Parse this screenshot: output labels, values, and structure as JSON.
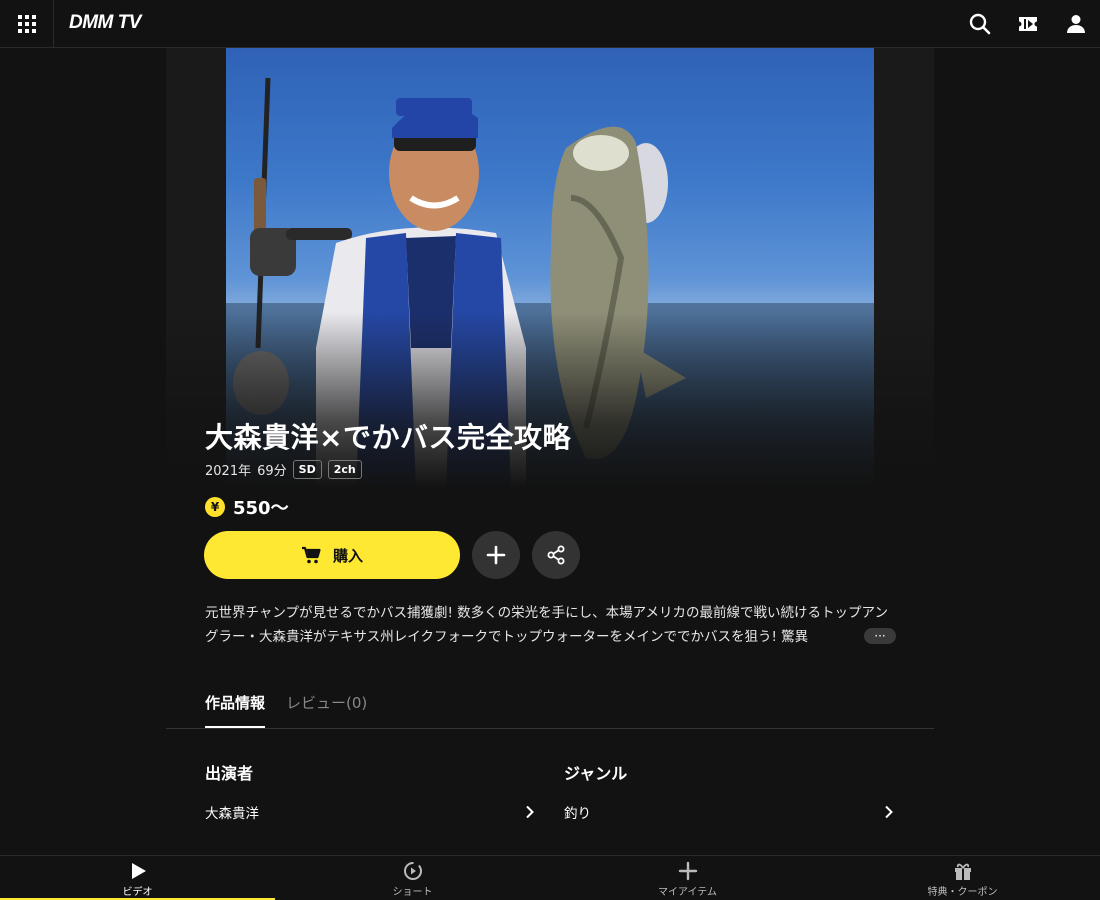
{
  "header": {
    "logo": "DMM TV",
    "icons": [
      "apps-grid-icon",
      "search-icon",
      "ticket-icon",
      "user-icon"
    ]
  },
  "content": {
    "title": "大森貴洋×でかバス完全攻略",
    "year": "2021年",
    "duration": "69分",
    "badges": [
      "SD",
      "2ch"
    ],
    "price": "550〜",
    "buy_label": "購入",
    "description": "元世界チャンプが見せるでかバス捕獲劇! 数多くの栄光を手にし、本場アメリカの最前線で戦い続けるトップアングラー・大森貴洋がテキサス州レイクフォークでトップウォーターをメインででかバスを狙う! 驚異",
    "more_label": "···"
  },
  "tabs": [
    {
      "label": "作品情報",
      "active": true
    },
    {
      "label": "レビュー(0)",
      "active": false
    }
  ],
  "info": {
    "cast_title": "出演者",
    "cast_value": "大森貴洋",
    "genre_title": "ジャンル",
    "genre_value": "釣り"
  },
  "bottom_nav": [
    {
      "label": "ビデオ",
      "icon": "play-icon",
      "active": true
    },
    {
      "label": "ショート",
      "icon": "shorts-icon",
      "active": false
    },
    {
      "label": "マイアイテム",
      "icon": "plus-icon",
      "active": false
    },
    {
      "label": "特典・クーポン",
      "icon": "gift-icon",
      "active": false
    }
  ],
  "colors": {
    "accent": "#ffe832",
    "background": "#121212",
    "surface": "#333333"
  }
}
